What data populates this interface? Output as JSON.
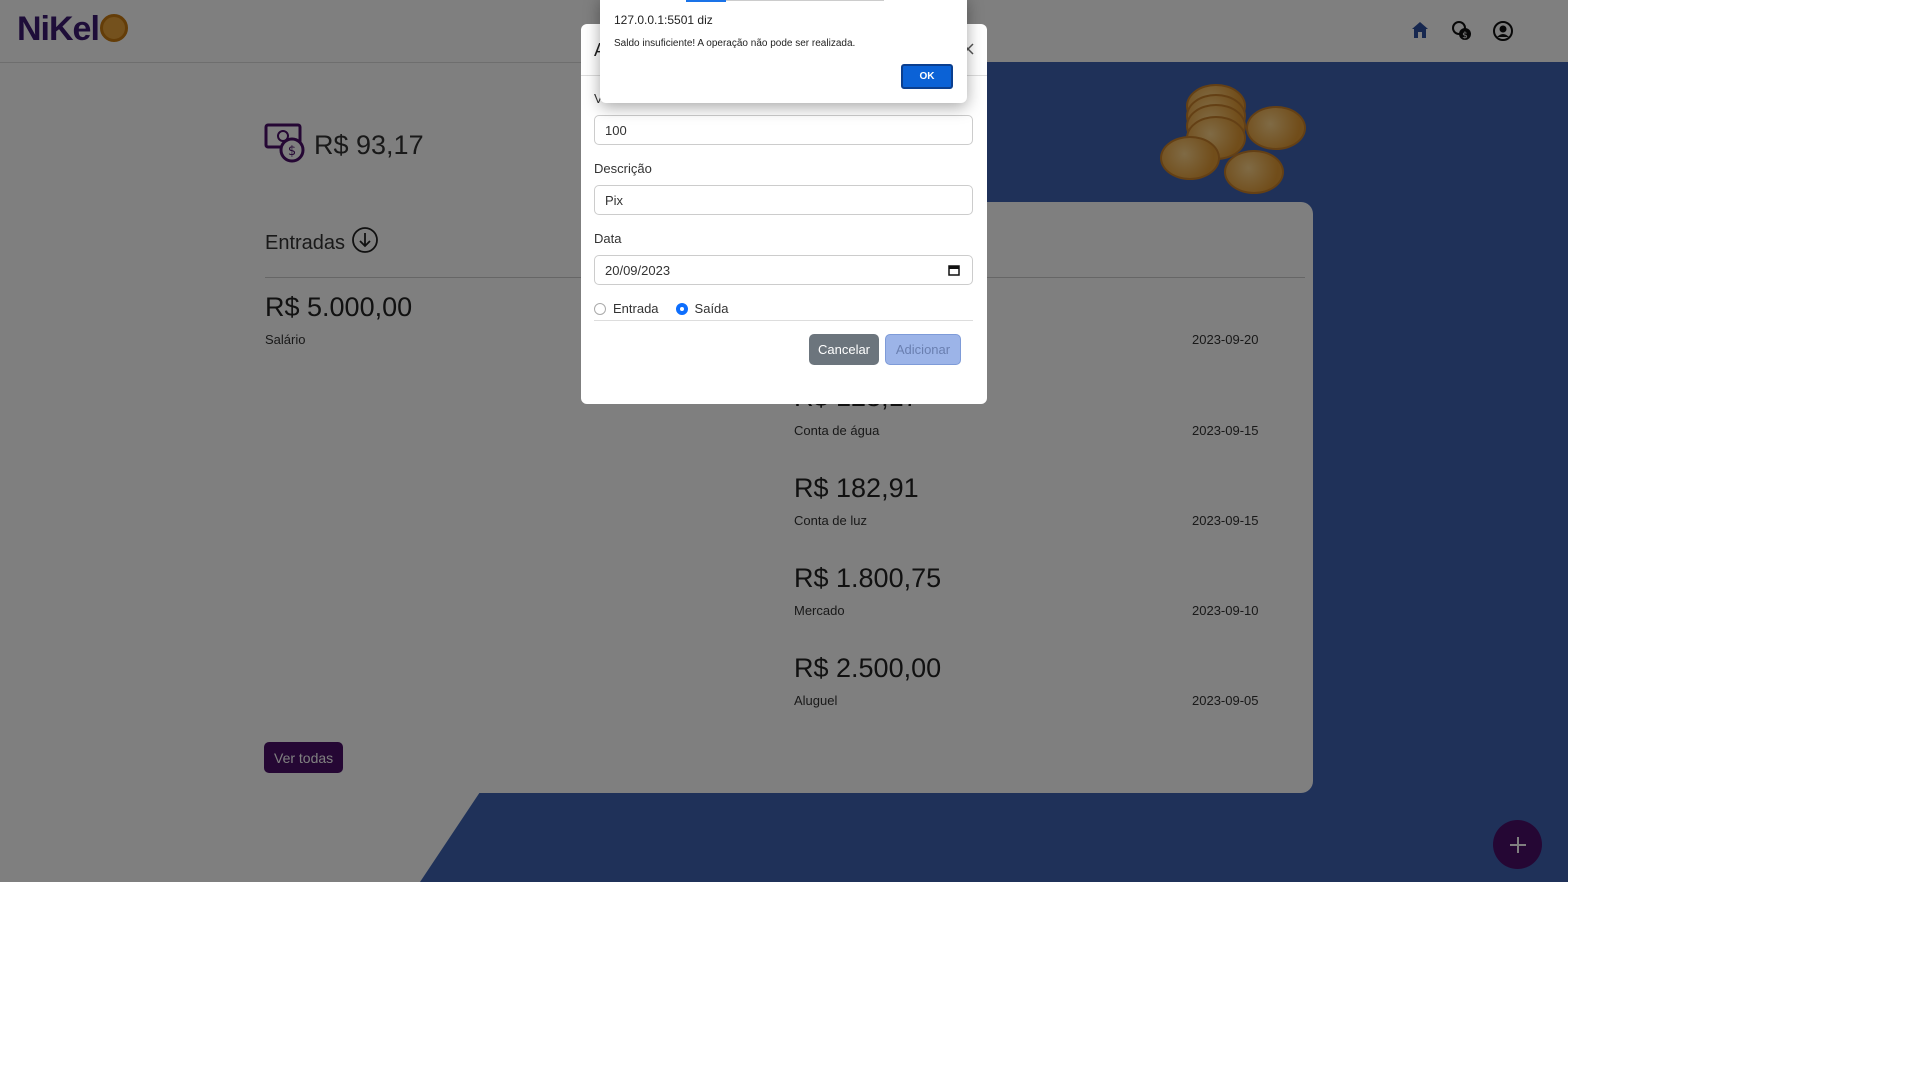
{
  "navbar": {
    "logo_text": "NiKel",
    "icons": [
      "home-icon",
      "money-exchange-icon",
      "user-circle-icon"
    ]
  },
  "balance": {
    "value": "R$ 93,17"
  },
  "incomes": {
    "title": "Entradas",
    "items": [
      {
        "amount": "R$ 5.000,00",
        "description": "Salário"
      }
    ],
    "view_all_label": "Ver todas"
  },
  "expenses": {
    "items": [
      {
        "amount": "R$ 123,17",
        "description": "Conta de água",
        "date": "2023-09-15"
      },
      {
        "amount": "R$ 182,91",
        "description": "Conta de luz",
        "date": "2023-09-15"
      },
      {
        "amount": "R$ 1.800,75",
        "description": "Mercado",
        "date": "2023-09-10"
      },
      {
        "amount": "R$ 2.500,00",
        "description": "Aluguel",
        "date": "2023-09-05"
      }
    ],
    "first_date": "2023-09-20"
  },
  "modal": {
    "title": "A",
    "value_label": "V",
    "value": "100",
    "description_label": "Descrição",
    "description": "Pix",
    "date_label": "Data",
    "date": "20/09/2023",
    "type_options": [
      "Entrada",
      "Saída"
    ],
    "selected_type": "Saída",
    "cancel_label": "Cancelar",
    "add_label": "Adicionar"
  },
  "alert": {
    "origin": "127.0.0.1:5501 diz",
    "message": "Saldo insuficiente! A operação não pode ser realizada.",
    "ok_label": "OK"
  },
  "colors": {
    "brand_purple": "#4a0e68",
    "blue_background": "#3f63b3",
    "primary_blue": "#0d6efd"
  }
}
